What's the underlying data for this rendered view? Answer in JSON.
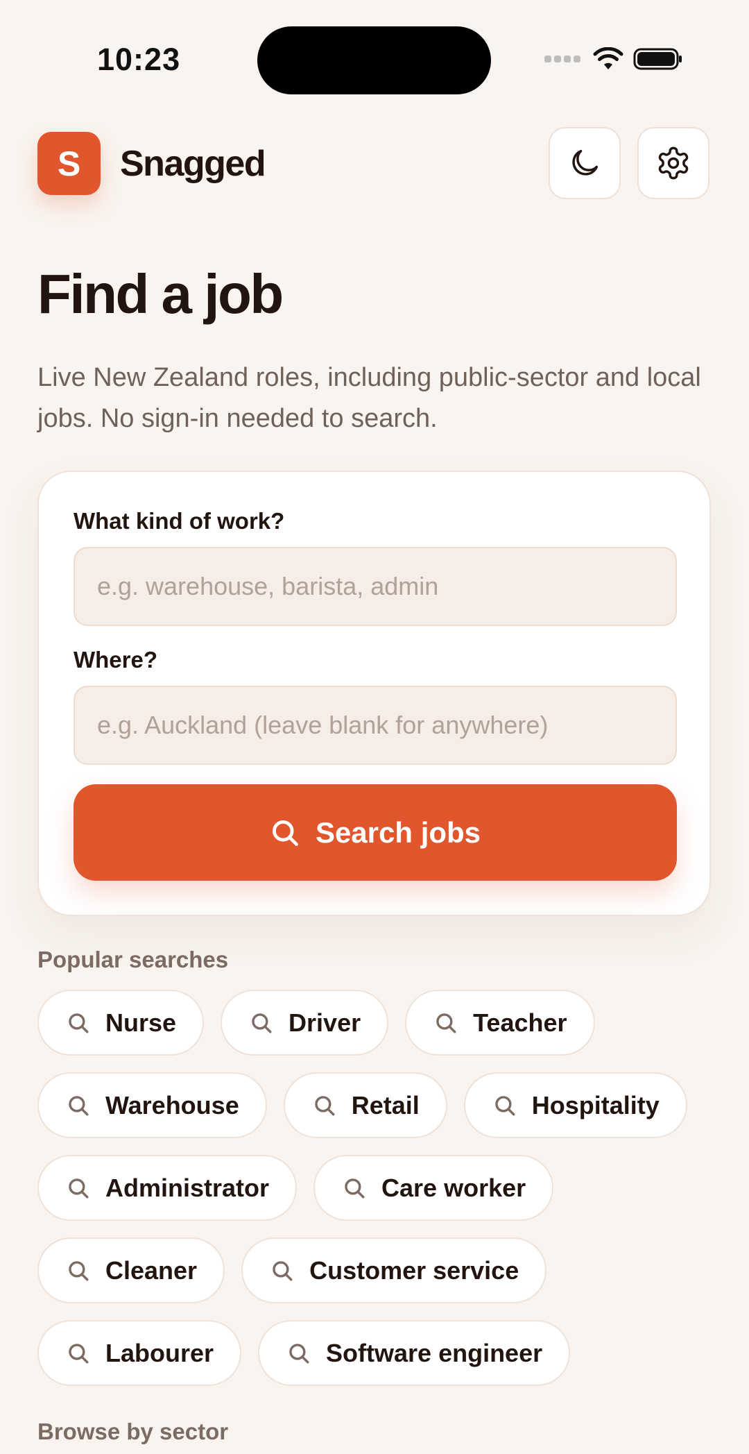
{
  "status_bar": {
    "time": "10:23"
  },
  "header": {
    "logo_letter": "S",
    "app_name": "Snagged",
    "theme_icon": "moon-icon",
    "settings_icon": "gear-icon"
  },
  "page": {
    "title": "Find a job",
    "subtitle": "Live New Zealand roles, including public-sector and local jobs. No sign-in needed to search."
  },
  "search": {
    "work_label": "What kind of work?",
    "work_placeholder": "e.g. warehouse, barista, admin",
    "work_value": "",
    "where_label": "Where?",
    "where_placeholder": "e.g. Auckland (leave blank for anywhere)",
    "where_value": "",
    "button_label": "Search jobs"
  },
  "popular": {
    "heading": "Popular searches",
    "chips": [
      "Nurse",
      "Driver",
      "Teacher",
      "Warehouse",
      "Retail",
      "Hospitality",
      "Administrator",
      "Care worker",
      "Cleaner",
      "Customer service",
      "Labourer",
      "Software engineer"
    ]
  },
  "browse": {
    "heading": "Browse by sector"
  },
  "colors": {
    "accent": "#e2562d",
    "background": "#f9f4ef",
    "text": "#22140f",
    "muted": "#7c6b62"
  }
}
